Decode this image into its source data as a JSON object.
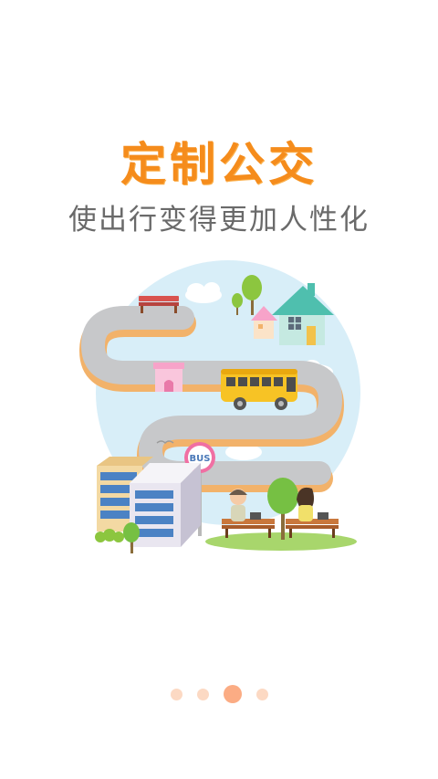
{
  "splash": {
    "title": "定制公交",
    "subtitle": "使出行变得更加人性化",
    "bus_sign_text": "BUS"
  },
  "pager": {
    "page_count": 4,
    "active_index": 2
  },
  "colors": {
    "title": "#f58c1c",
    "subtitle": "#6a6a6a",
    "dot_inactive": "#fcd9c3",
    "dot_active": "#fbac84",
    "sky_circle": "#d8eef8",
    "road": "#c7c8ca",
    "road_edge": "#f2b26a",
    "bus": "#f7c325"
  }
}
